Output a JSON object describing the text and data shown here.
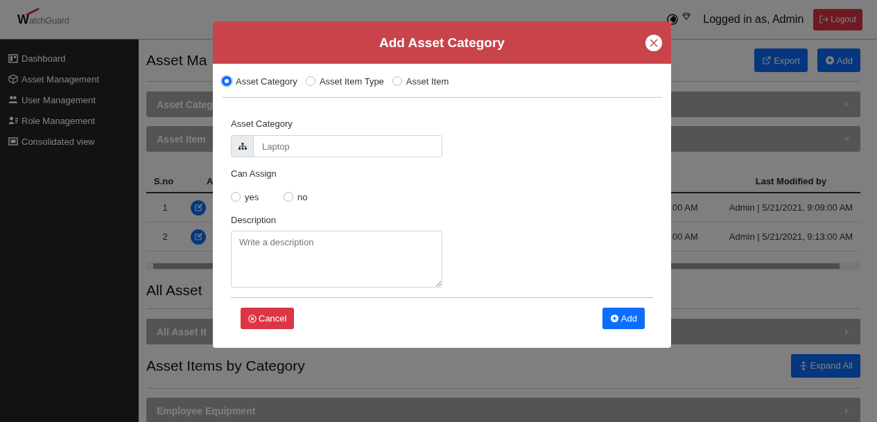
{
  "header": {
    "logo": "WatchGuard",
    "user_text": "Logged in as, Admin",
    "logout_button": "Logout"
  },
  "sidebar": {
    "items": [
      {
        "label": "Dashboard",
        "kind": "dashboard"
      },
      {
        "label": "Asset Management",
        "kind": "cube"
      },
      {
        "label": "User Management",
        "kind": "users"
      },
      {
        "label": "Role Management",
        "kind": "roles"
      },
      {
        "label": "Consolidated view",
        "kind": "monitor"
      }
    ]
  },
  "sections": [
    {
      "title": "Asset Ma",
      "buttons": [
        {
          "label": "Export",
          "kind": "export"
        },
        {
          "label": "Add",
          "kind": "add"
        }
      ],
      "panels": [
        {
          "title": "Asset Categ",
          "expanded": false
        },
        {
          "title": "Asset Item",
          "expanded": true,
          "table": {
            "columns": {
              "column_1": "S.no",
              "column_2": "A",
              "column_5": "Last Modified by"
            },
            "rows": [
              {
                "column_1": "1",
                "column_4": "00 AM",
                "column_5": "Admin | 5/21/2021, 9:09:00 AM"
              },
              {
                "column_1": "2",
                "column_4": "00 AM",
                "column_5": "Admin | 5/21/2021, 9:13:00 AM"
              }
            ]
          }
        }
      ]
    },
    {
      "title": "All Asset",
      "panels": [
        {
          "title": "All Asset It",
          "expanded": false
        }
      ]
    },
    {
      "title": "Asset Items by Category",
      "buttons": [
        {
          "label": "Expand All",
          "kind": "expand"
        }
      ],
      "panels": [
        {
          "title": "Employee Equipment",
          "expanded": false
        }
      ]
    }
  ],
  "modal": {
    "title": "Add Asset Category",
    "type_options": [
      {
        "label": "Asset Category",
        "selected": true
      },
      {
        "label": "Asset Item Type",
        "selected": false
      },
      {
        "label": "Asset Item",
        "selected": false
      }
    ],
    "fields": [
      {
        "kind": "input",
        "label": "Asset Category",
        "placeholder": "Laptop"
      },
      {
        "kind": "radio",
        "label": "Can Assign",
        "options": [
          {
            "label": "yes",
            "selected": false
          },
          {
            "label": "no",
            "selected": false
          }
        ]
      },
      {
        "kind": "textarea",
        "label": "Description",
        "placeholder": "Write a description"
      }
    ],
    "cancel_button": "Cancel",
    "add_button": "Add"
  }
}
